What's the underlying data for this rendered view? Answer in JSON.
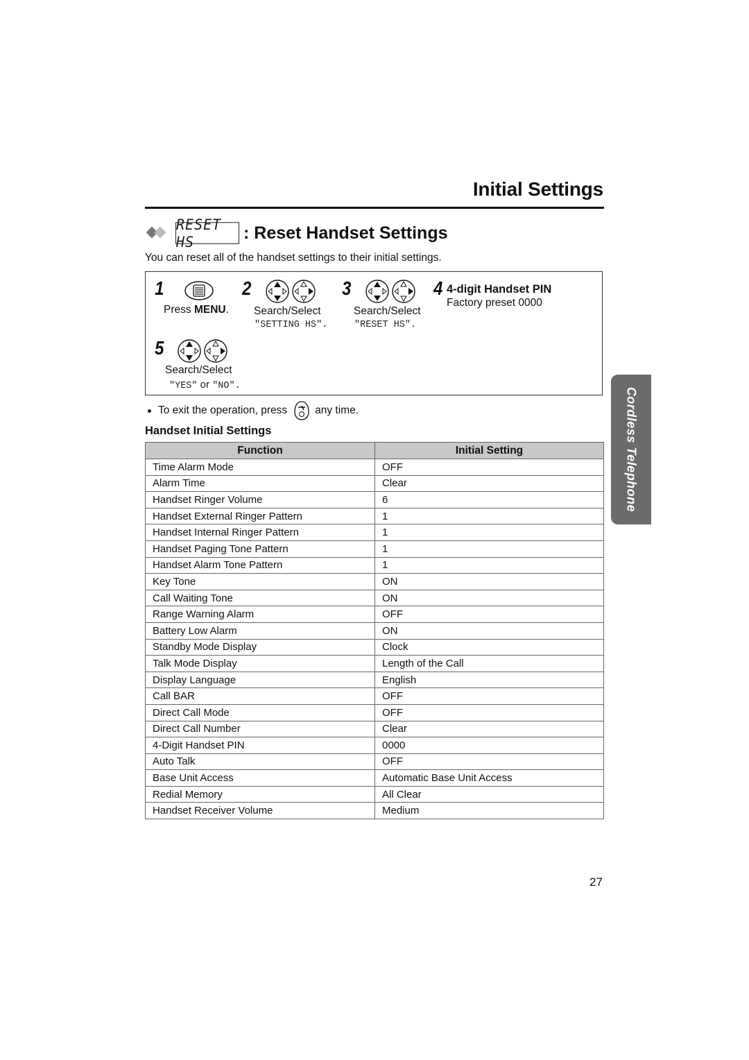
{
  "header": {
    "page_title": "Initial Settings"
  },
  "section": {
    "lcd_label": "RESET HS",
    "title": ": Reset Handset Settings",
    "intro": "You can reset all of the handset settings to their initial settings."
  },
  "steps": [
    {
      "number": "1",
      "icon": "menu-button-icon",
      "label_prefix": "Press ",
      "label_bold": "MENU",
      "label_suffix": "."
    },
    {
      "number": "2",
      "icon": "navigator-key-icon",
      "label": "Search/Select",
      "mono": "\"SETTING HS\"."
    },
    {
      "number": "3",
      "icon": "navigator-key-icon",
      "label": "Search/Select",
      "mono": "\"RESET HS\"."
    },
    {
      "number": "4",
      "title": "4-digit Handset PIN",
      "note": "Factory preset 0000"
    },
    {
      "number": "5",
      "icon": "navigator-key-icon",
      "label": "Search/Select",
      "mono_yes": "\"YES\"",
      "or": " or ",
      "mono_no": "\"NO\"",
      "end": "."
    }
  ],
  "exit_note": {
    "before": "To exit the operation, press",
    "icon": "off-button-icon",
    "after": "any time."
  },
  "table": {
    "heading": "Handset Initial Settings",
    "columns": [
      "Function",
      "Initial Setting"
    ],
    "rows": [
      [
        "Time Alarm Mode",
        "OFF"
      ],
      [
        "Alarm Time",
        "Clear"
      ],
      [
        "Handset Ringer Volume",
        "6"
      ],
      [
        "Handset External Ringer Pattern",
        "1"
      ],
      [
        "Handset Internal Ringer Pattern",
        "1"
      ],
      [
        "Handset Paging Tone Pattern",
        "1"
      ],
      [
        "Handset Alarm Tone Pattern",
        "1"
      ],
      [
        "Key Tone",
        "ON"
      ],
      [
        "Call Waiting Tone",
        "ON"
      ],
      [
        "Range Warning Alarm",
        "OFF"
      ],
      [
        "Battery Low Alarm",
        "ON"
      ],
      [
        "Standby Mode Display",
        "Clock"
      ],
      [
        "Talk Mode Display",
        "Length of the Call"
      ],
      [
        "Display Language",
        "English"
      ],
      [
        "Call BAR",
        "OFF"
      ],
      [
        "Direct Call Mode",
        "OFF"
      ],
      [
        "Direct Call Number",
        "Clear"
      ],
      [
        "4-Digit Handset PIN",
        "0000"
      ],
      [
        "Auto Talk",
        "OFF"
      ],
      [
        "Base Unit Access",
        "Automatic Base Unit Access"
      ],
      [
        "Redial Memory",
        "All Clear"
      ],
      [
        "Handset Receiver Volume",
        "Medium"
      ]
    ]
  },
  "side_tab": {
    "label": "Cordless Telephone",
    "color": "#6b6b6b"
  },
  "footer": {
    "page_number": "27"
  }
}
